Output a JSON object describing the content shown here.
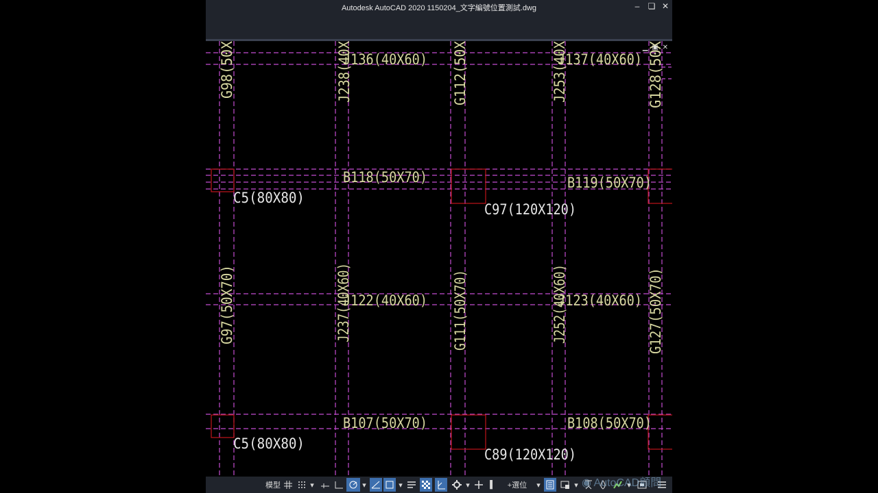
{
  "window": {
    "title": "Autodesk AutoCAD 2020    1150204_文字編號位置測試.dwg",
    "minimize_icon": "minimize-icon",
    "restore_icon": "restore-icon",
    "close_icon": "close-icon"
  },
  "viewport_controls": {
    "minimize": "▁",
    "restore": "▣",
    "close": "✕"
  },
  "drawing": {
    "colors": {
      "gridline": "#c44dd1",
      "column": "#c0141a",
      "label_yellow": "#d7d7a0",
      "label_white": "#e8e8e8"
    },
    "horizontal_labels": [
      {
        "text": "J136(40X60)",
        "color": "yellow"
      },
      {
        "text": "J137(40X60)",
        "color": "yellow"
      },
      {
        "text": "B118(50X70)",
        "color": "yellow"
      },
      {
        "text": "B119(50X70)",
        "color": "yellow"
      },
      {
        "text": "J122(40X60)",
        "color": "yellow"
      },
      {
        "text": "J123(40X60)",
        "color": "yellow"
      },
      {
        "text": "B107(50X70)",
        "color": "yellow"
      },
      {
        "text": "B108(50X70)",
        "color": "yellow"
      }
    ],
    "column_labels": [
      {
        "text": "C5(80X80)"
      },
      {
        "text": "C97(120X120)"
      },
      {
        "text": "C5(80X80)"
      },
      {
        "text": "C89(120X120)"
      }
    ],
    "vertical_labels": [
      {
        "text": "G98(50X"
      },
      {
        "text": "J238(40X"
      },
      {
        "text": "G112(50X"
      },
      {
        "text": "J253(40X"
      },
      {
        "text": "G128(50X"
      },
      {
        "text": "G97(50X70)"
      },
      {
        "text": "J237(40X60)"
      },
      {
        "text": "G111(50X70)"
      },
      {
        "text": "J252(40X60)"
      },
      {
        "text": "G127(50X70)"
      }
    ]
  },
  "statusbar": {
    "model_label": "模型",
    "grid_icon": "grid-icon",
    "snap_icon": "snap-icon",
    "infer_icon": "infer-constraints-icon",
    "ortho_icon": "ortho-icon",
    "polar_icon": "polar-tracking-icon",
    "isodraft_icon": "isodraft-icon",
    "osnap_icon": "object-snap-icon",
    "lineweight_icon": "lineweight-icon",
    "transparency_icon": "transparency-icon",
    "selection_cycle_icon": "selection-cycling-icon",
    "gizmo_icon": "gizmo-icon",
    "annotation_icon": "annotation-monitor-icon",
    "select_label": "+選位",
    "units_icon": "units-icon",
    "quickprops_icon": "quick-properties-icon",
    "workspace_icon": "workspace-icon",
    "isolate_icon": "isolate-objects-icon",
    "hardware_icon": "hardware-acceleration-icon",
    "clean_screen_icon": "clean-screen-icon",
    "customize_icon": "customization-icon"
  },
  "watermark": {
    "text": "AutoCAD顧問"
  }
}
